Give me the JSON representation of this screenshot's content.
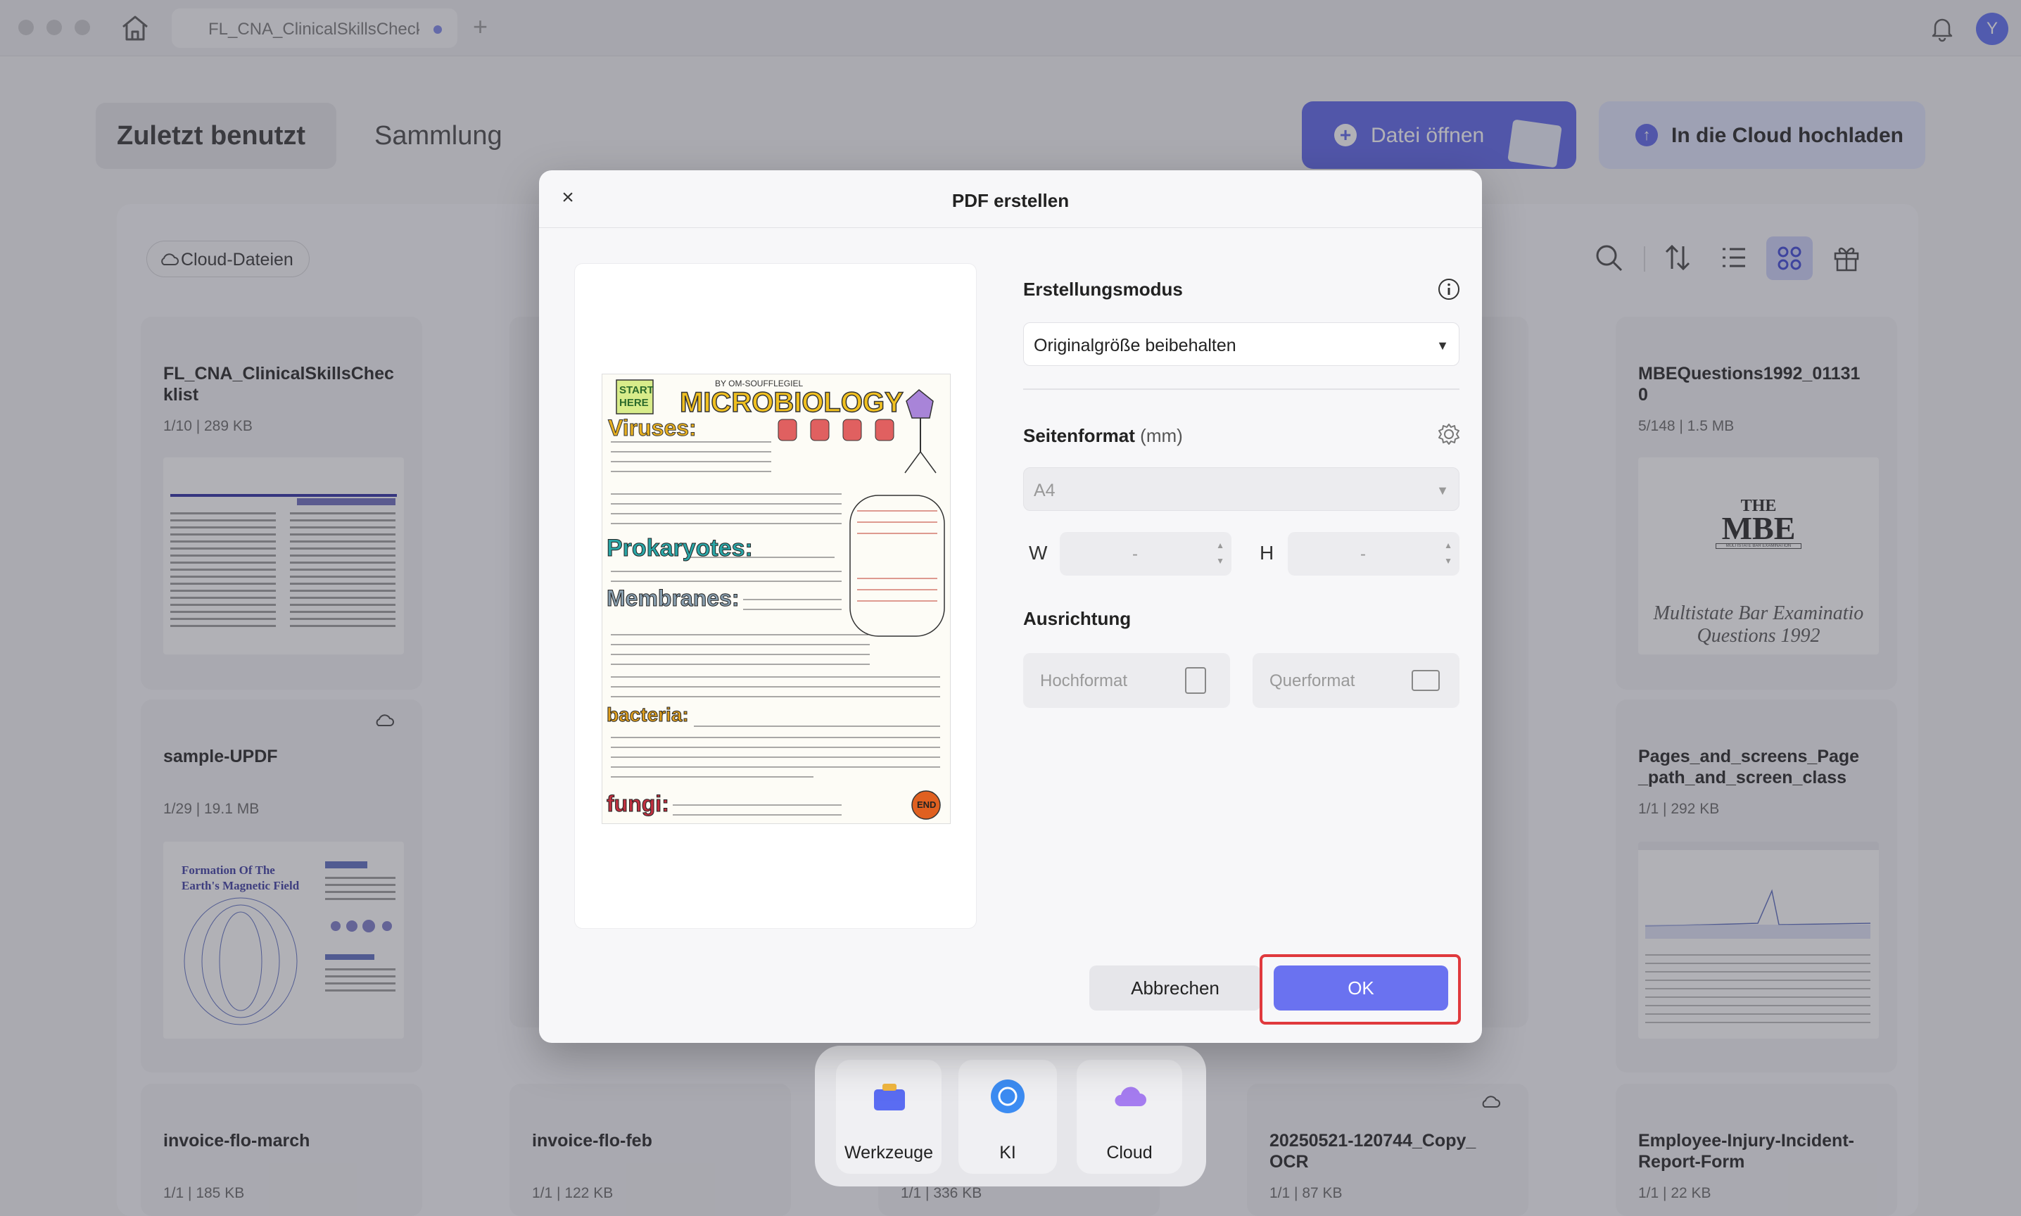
{
  "titlebar": {
    "tab_title": "FL_CNA_ClinicalSkillsChecklist",
    "avatar_initial": "Y"
  },
  "nav": {
    "recent": "Zuletzt benutzt",
    "collection": "Sammlung",
    "open_file": "Datei öffnen",
    "upload_cloud": "In die Cloud hochladen"
  },
  "filter": {
    "cloud_files": "Cloud-Dateien"
  },
  "files": [
    {
      "title": "FL_CNA_ClinicalSkillsChec\nklist",
      "meta": "1/10  |  289 KB"
    },
    {
      "title": "MBEQuestions1992_01131\n0",
      "meta": "5/148  |  1.5 MB",
      "thumb_line1": "THE",
      "thumb_line2": "MBE",
      "thumb_line3": "MULTISTATE BAR EXAMINATION",
      "thumb_caption": "Multistate Bar Examinatio\nQuestions 1992"
    },
    {
      "title": "sample-UPDF",
      "meta": "1/29  |  19.1 MB",
      "thumb_heading": "Formation Of The\nEarth's Magnetic Field"
    },
    {
      "title": "Pages_and_screens_Page\n_path_and_screen_class",
      "meta": "1/1  |  292 KB"
    },
    {
      "title": "invoice-flo-march",
      "meta": "1/1  |  185 KB"
    },
    {
      "title": "invoice-flo-feb",
      "meta": "1/1  |  122 KB"
    },
    {
      "meta": "1/1  |  336 KB"
    },
    {
      "title": "20250521-120744_Copy_\nOCR",
      "meta": "1/1  |  87 KB"
    },
    {
      "title": "Employee-Injury-Incident-\nReport-Form",
      "meta": "1/1  |  22 KB"
    }
  ],
  "dialog": {
    "title": "PDF erstellen",
    "close": "×",
    "mode_label": "Erstellungsmodus",
    "mode_value": "Originalgröße beibehalten",
    "format_label": "Seitenformat",
    "format_unit": "(mm)",
    "format_value": "A4",
    "w_label": "W",
    "h_label": "H",
    "w_value": "-",
    "h_value": "-",
    "orientation_label": "Ausrichtung",
    "portrait": "Hochformat",
    "landscape": "Querformat",
    "cancel": "Abbrechen",
    "ok": "OK",
    "preview": {
      "badge_start": "START\nHERE",
      "heading": "MICROBIOLOGY",
      "byline": "BY OM-SOUFFLEGIEL",
      "viruses": "Viruses:",
      "prokaryotes": "Prokaryotes:",
      "membranes": "Membranes:",
      "bacteria": "bacteria:",
      "fungi": "fungi:",
      "end": "END"
    }
  },
  "dock": {
    "tools": "Werkzeuge",
    "ai": "KI",
    "cloud": "Cloud"
  },
  "colors": {
    "accent": "#5b63e8",
    "highlight_frame": "#e0393d"
  }
}
